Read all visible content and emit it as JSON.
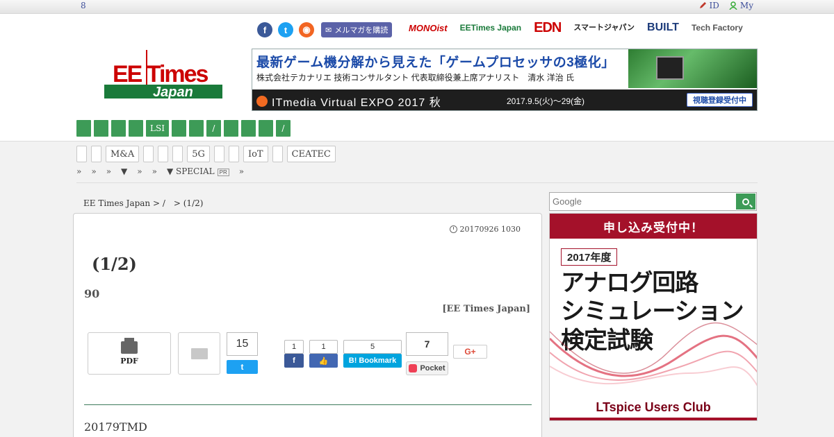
{
  "topbar": {
    "date": "8",
    "login_label": "ID",
    "mypage_label": "My"
  },
  "header": {
    "tagline": "",
    "mail_label": "メルマガを購読",
    "sites": [
      "MONOist",
      "EETimes Japan",
      "EDN",
      "スマートジャパン",
      "BUILT",
      "Tech Factory"
    ],
    "logo_top": "EE Times",
    "logo_bottom": "Japan"
  },
  "banner": {
    "line1": "最新ゲーム機分解から見えた「ゲームプロセッサの3極化」",
    "line2": "株式会社テカナリエ 技術コンサルタント 代表取締役兼上席アナリスト　清水 洋治 氏",
    "expo": "ITmedia Virtual EXPO 2017 秋",
    "dates": "2017.9.5(火)～29(金)",
    "register": "視聴登録受付中"
  },
  "green_nav": [
    "",
    "",
    "",
    "",
    "LSI",
    "",
    "",
    "/",
    "",
    "",
    "",
    "/"
  ],
  "sub_nav": [
    "",
    "",
    "M&A",
    "",
    "",
    "",
    "5G",
    "",
    "",
    "IoT",
    "",
    "CEATEC"
  ],
  "sub_nav2": [
    "»",
    "»",
    "»",
    "▼",
    "»",
    "»",
    "▼ SPECIAL",
    "»"
  ],
  "sub_nav2_pr": "PR",
  "breadcrumb": "EE Times Japan > /　>  (1/2)",
  "article": {
    "timestamp": "20170926 1030",
    "title": "(1/2)",
    "number": "90",
    "byline": "[EE Times Japan]",
    "pdf_label": "PDF",
    "tweet_count": "15",
    "fb_count": "1",
    "like_count": "1",
    "hatena_count": "5",
    "hatena_label": "Bookmark",
    "pocket_count": "7",
    "pocket_label": "Pocket",
    "gplus_label": "G+",
    "lead": "20179TMD"
  },
  "search": {
    "placeholder": "Google"
  },
  "ad": {
    "head": "申し込み受付中！",
    "year": "2017年度",
    "line1": "アナログ回路",
    "line2": "シミュレーション",
    "line3": "検定試験",
    "footer": "LTspice Users Club"
  }
}
